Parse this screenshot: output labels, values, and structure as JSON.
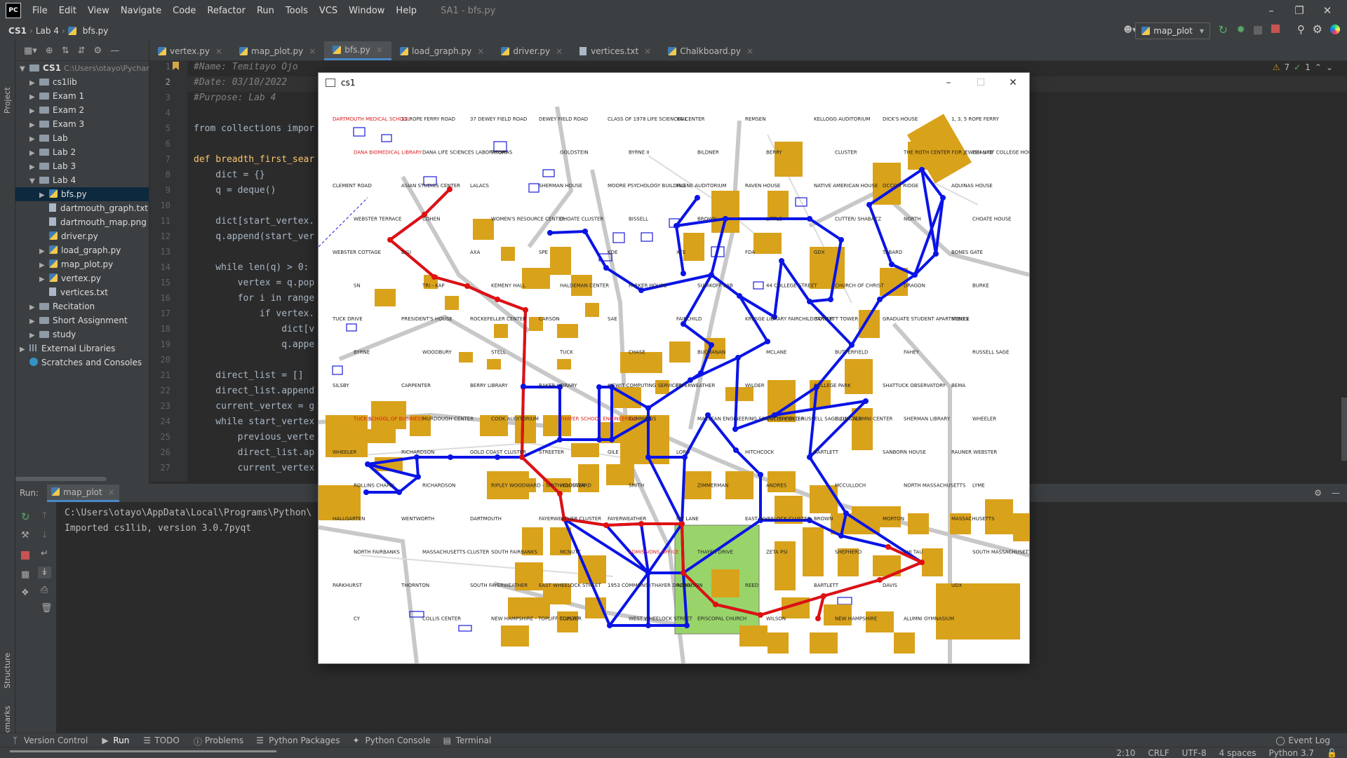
{
  "menubar": {
    "logo": "PC",
    "items": [
      "File",
      "Edit",
      "View",
      "Navigate",
      "Code",
      "Refactor",
      "Run",
      "Tools",
      "VCS",
      "Window",
      "Help"
    ],
    "window_title": "SA1 - bfs.py"
  },
  "navbar": {
    "crumbs": [
      "CS1",
      "Lab 4",
      "bfs.py"
    ],
    "run_config": "map_plot"
  },
  "project": {
    "root_name": "CS1",
    "root_path": "C:\\Users\\otayo\\Pychar",
    "items": [
      {
        "label": "cs1lib",
        "type": "folder",
        "depth": 1
      },
      {
        "label": "Exam 1",
        "type": "folder",
        "depth": 1
      },
      {
        "label": "Exam 2",
        "type": "folder",
        "depth": 1
      },
      {
        "label": "Exam 3",
        "type": "folder",
        "depth": 1
      },
      {
        "label": "Lab",
        "type": "folder",
        "depth": 1
      },
      {
        "label": "Lab 2",
        "type": "folder",
        "depth": 1
      },
      {
        "label": "Lab 3",
        "type": "folder",
        "depth": 1
      },
      {
        "label": "Lab 4",
        "type": "folder",
        "depth": 1,
        "open": true
      },
      {
        "label": "bfs.py",
        "type": "py",
        "depth": 2,
        "selected": true
      },
      {
        "label": "dartmouth_graph.txt",
        "type": "file",
        "depth": 2
      },
      {
        "label": "dartmouth_map.png",
        "type": "file",
        "depth": 2
      },
      {
        "label": "driver.py",
        "type": "py",
        "depth": 2
      },
      {
        "label": "load_graph.py",
        "type": "py",
        "depth": 2
      },
      {
        "label": "map_plot.py",
        "type": "py",
        "depth": 2
      },
      {
        "label": "vertex.py",
        "type": "py",
        "depth": 2
      },
      {
        "label": "vertices.txt",
        "type": "file",
        "depth": 2
      },
      {
        "label": "Recitation",
        "type": "folder",
        "depth": 1
      },
      {
        "label": "Short Assignment",
        "type": "folder",
        "depth": 1
      },
      {
        "label": "study",
        "type": "folder",
        "depth": 1
      },
      {
        "label": "External Libraries",
        "type": "lib",
        "depth": 0
      },
      {
        "label": "Scratches and Consoles",
        "type": "scratch",
        "depth": 0
      }
    ]
  },
  "tabs": [
    {
      "label": "vertex.py",
      "active": false
    },
    {
      "label": "map_plot.py",
      "active": false
    },
    {
      "label": "bfs.py",
      "active": true
    },
    {
      "label": "load_graph.py",
      "active": false
    },
    {
      "label": "driver.py",
      "active": false
    },
    {
      "label": "vertices.txt",
      "active": false
    },
    {
      "label": "Chalkboard.py",
      "active": false
    }
  ],
  "editor": {
    "line_numbers": [
      "1",
      "2",
      "3",
      "4",
      "5",
      "6",
      "7",
      "8",
      "9",
      "10",
      "11",
      "12",
      "13",
      "14",
      "15",
      "16",
      "17",
      "18",
      "19",
      "20",
      "21",
      "22",
      "23",
      "24",
      "25",
      "26",
      "27"
    ],
    "lines": [
      "#Name: Temitayo Ojo",
      "#Date: 03/10/2022",
      "#Purpose: Lab 4",
      "",
      "from collections impor",
      "",
      "def breadth_first_sear",
      "    dict = {}",
      "    q = deque()",
      "",
      "    dict[start_vertex.",
      "    q.append(start_ver",
      "",
      "    while len(q) > 0:",
      "        vertex = q.pop",
      "        for i in range",
      "            if vertex.",
      "                dict[v",
      "                q.appe",
      "",
      "    direct_list = []",
      "    direct_list.append",
      "    current_vertex = g",
      "    while start_vertex",
      "        previous_verte",
      "        direct_list.ap",
      "        current_vertex"
    ],
    "inspections": {
      "warnings": "7",
      "ok": "1"
    }
  },
  "run": {
    "label": "Run:",
    "config": "map_plot",
    "output": [
      "C:\\Users\\otayo\\AppData\\Local\\Programs\\Python\\",
      "Imported cs1lib, version 3.0.7pyqt"
    ]
  },
  "sidebar_labels": {
    "project": "Project",
    "structure": "Structure",
    "bookmarks": "Bookmarks"
  },
  "bottom_tools": [
    "Version Control",
    "Run",
    "TODO",
    "Problems",
    "Python Packages",
    "Python Console",
    "Terminal"
  ],
  "event_log": "Event Log",
  "status": {
    "position": "2:10",
    "line_sep": "CRLF",
    "encoding": "UTF-8",
    "indent": "4 spaces",
    "interpreter": "Python 3.7"
  },
  "cs1_window": {
    "title": "cs1",
    "colors": {
      "graph_edge": "#0a14e6",
      "path_edge": "#e01010",
      "building": "#d9a21b",
      "green": "#99d46b"
    },
    "labels": [
      "DARTMOUTH MEDICAL SCHOOL",
      "11 ROPE FERRY ROAD",
      "37 DEWEY FIELD ROAD",
      "DEWEY FIELD ROAD",
      "CLASS OF 1978 LIFE SCIENCES CENTER",
      "VAIL",
      "REMSEN",
      "KELLOGG AUDITORIUM",
      "DICK'S HOUSE",
      "1, 3, 5 ROPE FERRY",
      "DANA BIOMEDICAL LIBRARY",
      "DANA LIFE SCIENCES LABORATORY",
      "THOMAS",
      "GOLDSTEIN",
      "BYRNE II",
      "BILDNER",
      "BERRY",
      "CLUSTER",
      "THE ROTH CENTER FOR JEWISH LIFE",
      "DEAN OF COLLEGE HOUSE",
      "CLEMENT ROAD",
      "ASIAN STUDIES CENTER",
      "LALACS",
      "SHERMAN HOUSE",
      "MOORE PSYCHOLOGY BUILDING",
      "FILENE AUDITORIUM",
      "RAVEN HOUSE",
      "NATIVE AMERICAN HOUSE",
      "OCCOM RIDGE",
      "AQUINAS HOUSE",
      "WEBSTER TERRACE",
      "COHEN",
      "WOMEN'S RESOURCE CENTER",
      "CHOATE CLUSTER",
      "BISSELL",
      "BROWN",
      "LITTLE",
      "CUTTER/ SHABAZZ",
      "NORTH",
      "CHOATE HOUSE",
      "WEBSTER COTTAGE",
      "EKU",
      "AXA",
      "SPE",
      "KDE",
      "XTE",
      "FDA",
      "GDX",
      "TABARD",
      "BONES GATE",
      "SN",
      "TRI - KAP",
      "KEMENY HALL",
      "HALDEMAN CENTER",
      "PARKER HOUSE",
      "SUDIKOFF LAB",
      "44 COLLEGE STREET",
      "CHURCH OF CHRIST",
      "DRAGON",
      "BURKE",
      "TUCK DRIVE",
      "PRESIDENT'S HOUSE",
      "ROCKEFELLER CENTER",
      "CARSON",
      "SAE",
      "FAIRCHILD",
      "KRESGE LIBRARY FAIRCHILD TOWER",
      "BARTLETT TOWER",
      "GRADUATE STUDENT APARTMENTS",
      "STEELE",
      "BYRNE",
      "WOODBURY",
      "STELL",
      "TUCK",
      "CHASE",
      "BUCHANAN",
      "MCLANE",
      "BUTTERFIELD",
      "FAHEY",
      "RUSSELL SAGE",
      "SILSBY",
      "CARPENTER",
      "BERRY LIBRARY",
      "BAKER LIBRARY",
      "KIEWIT COMPUTING SERVICES",
      "FAYERWEATHER",
      "WILDER",
      "COLLEGE PARK",
      "SHATTUCK OBSERVATORY",
      "BEMA",
      "TUCK SCHOOL OF BUSINESS",
      "MURDOUGH CENTER",
      "COOK AUDITORIUM",
      "THAYER SCHOOL ENGINEERING",
      "CUMMINGS",
      "MACLEAN ENGINEERING SCIENCES CENTER",
      "BUTTERFIELD-RUSSELL SAGE CLUSTER",
      "BLUNT ALUMNI CENTER",
      "SHERMAN LIBRARY",
      "WHEELER",
      "WHEELER",
      "RICHARDSON",
      "GOLD COAST CLUSTER",
      "STREETER",
      "GILE",
      "LORD",
      "HITCHCOCK",
      "BARTLETT",
      "SANBORN HOUSE",
      "RAUNER WEBSTER",
      "ROLLINS CHAPEL",
      "RICHARDSON",
      "RIPLEY WOODWARD - SMITH CLUSTER",
      "WOODWARD",
      "SMITH",
      "ZIMMERMAN",
      "ANDRES",
      "MCCULLOCH",
      "NORTH MASSACHUSETTS",
      "LYME",
      "HALLGARTEN",
      "WENTWORTH",
      "DARTMOUTH",
      "FAYERWEATHER CLUSTER",
      "FAYERWEATHER",
      "IVY LANE",
      "EAST WHEELOCK CLUSTER",
      "BROWN",
      "MORTON",
      "MASSACHUSETTS",
      "NORTH FAIRBANKS",
      "MASSACHUSETTS CLUSTER",
      "SOUTH FAIRBANKS",
      "MCNUTT",
      "ADMISSIONS OFFICE",
      "THAYER DRIVE",
      "ZETA PSI",
      "SHEPHERD",
      "PHI TAU",
      "SOUTH MASSACHUSETTS",
      "PARKHURST",
      "THORNTON",
      "SOUTH FAYERWEATHER",
      "EAST WHEELOCK STREET",
      "1953 COMMONS (THAYER DINING)",
      "ROBINSON",
      "REED",
      "BARTLETT",
      "DAVIS",
      "UDX",
      "CY",
      "COLLIS CENTER",
      "NEW HAMPSHIRE - TOPLIFF CLUSTER",
      "TOPLIFF",
      "WEST WHEELOCK STREET",
      "EPISCOPAL CHURCH",
      "WILSON",
      "NEW HAMPSHIRE",
      "ALUMNI GYMNASIUM"
    ]
  }
}
